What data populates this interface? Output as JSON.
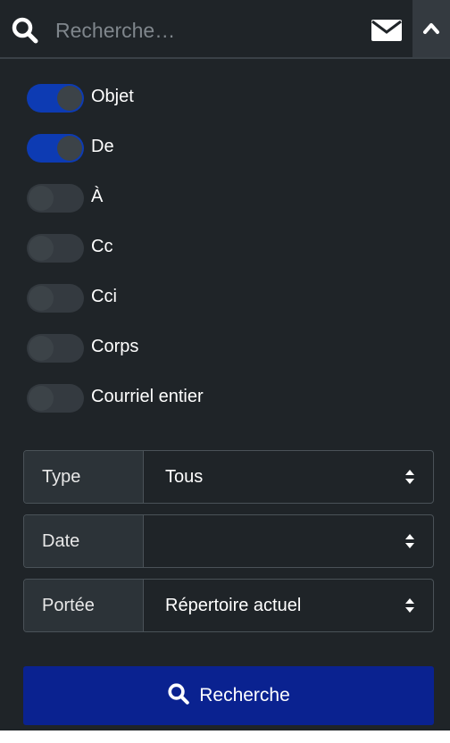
{
  "search": {
    "placeholder": "Recherche…",
    "value": ""
  },
  "header": {
    "mail_icon": "envelope-icon",
    "collapse_icon": "chevron-up-icon"
  },
  "toggles": [
    {
      "label": "Objet",
      "on": true
    },
    {
      "label": "De",
      "on": true
    },
    {
      "label": "À",
      "on": false
    },
    {
      "label": "Cc",
      "on": false
    },
    {
      "label": "Cci",
      "on": false
    },
    {
      "label": "Corps",
      "on": false
    },
    {
      "label": "Courriel entier",
      "on": false
    }
  ],
  "filters": {
    "type": {
      "label": "Type",
      "value": "Tous"
    },
    "date": {
      "label": "Date",
      "value": ""
    },
    "scope": {
      "label": "Portée",
      "value": "Répertoire actuel"
    }
  },
  "submit": {
    "label": "Recherche"
  },
  "colors": {
    "panel_bg": "#1f2428",
    "toggle_on": "#0d3bb3",
    "toggle_off": "#343a40",
    "button_bg": "#0a2290"
  }
}
